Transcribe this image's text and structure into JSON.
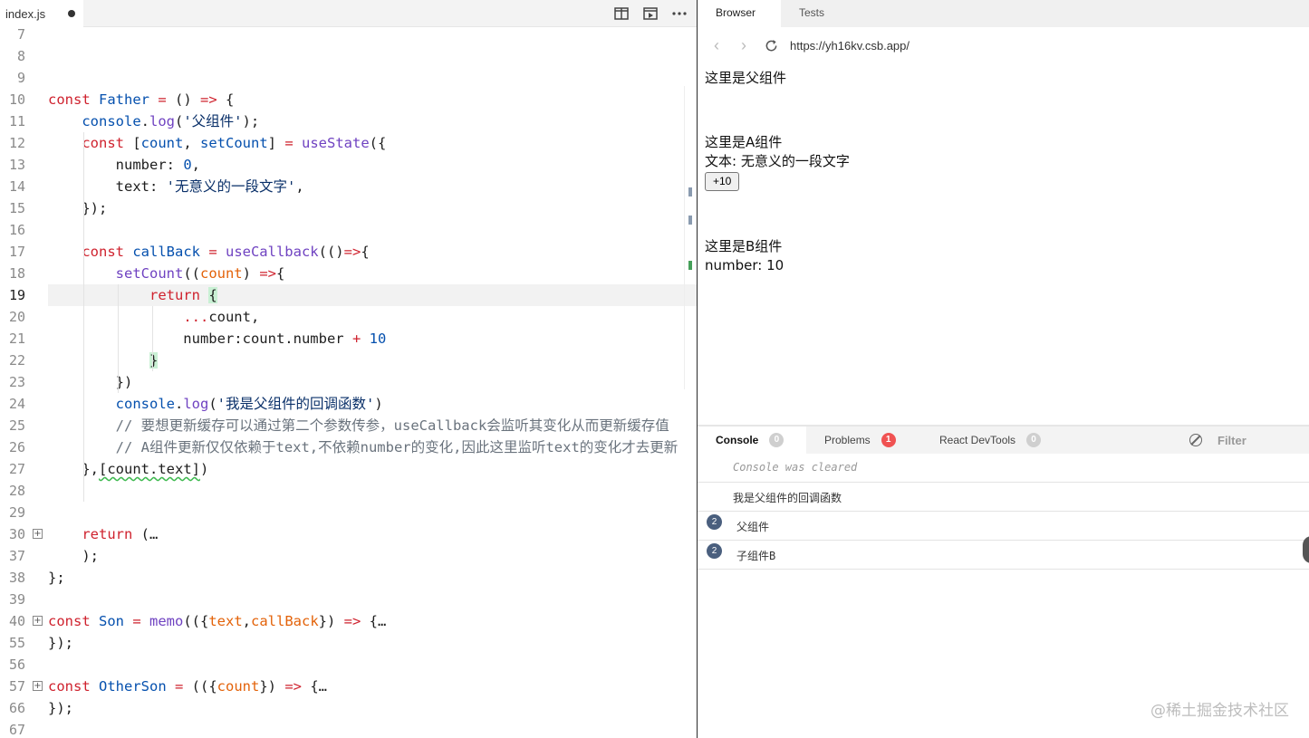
{
  "editor": {
    "file_name": "index.js",
    "actions": [
      "split-editor-icon",
      "preview-icon",
      "more-icon"
    ],
    "lines": [
      {
        "n": "7",
        "segs": []
      },
      {
        "n": "8",
        "segs": []
      },
      {
        "n": "9",
        "segs": []
      },
      {
        "n": "10",
        "segs": [
          [
            "kw",
            "const "
          ],
          [
            "vr",
            "Father"
          ],
          [
            "op",
            " = "
          ],
          [
            "",
            "() "
          ],
          [
            "op",
            "=>"
          ],
          [
            "",
            " {"
          ]
        ]
      },
      {
        "n": "11",
        "segs": [
          [
            "",
            "    "
          ],
          [
            "vr",
            "console"
          ],
          [
            "",
            "."
          ],
          [
            "fn",
            "log"
          ],
          [
            "",
            "("
          ],
          [
            "str",
            "'父组件'"
          ],
          [
            "",
            ");"
          ]
        ]
      },
      {
        "n": "12",
        "segs": [
          [
            "",
            "    "
          ],
          [
            "kw",
            "const "
          ],
          [
            "",
            "["
          ],
          [
            "vr",
            "count"
          ],
          [
            "",
            ", "
          ],
          [
            "vr",
            "setCount"
          ],
          [
            "",
            "] "
          ],
          [
            "op",
            "= "
          ],
          [
            "fn",
            "useState"
          ],
          [
            "",
            "({"
          ]
        ]
      },
      {
        "n": "13",
        "segs": [
          [
            "",
            "        number: "
          ],
          [
            "num",
            "0"
          ],
          [
            "",
            ","
          ]
        ]
      },
      {
        "n": "14",
        "segs": [
          [
            "",
            "        text: "
          ],
          [
            "str",
            "'无意义的一段文字'"
          ],
          [
            "",
            ","
          ]
        ]
      },
      {
        "n": "15",
        "segs": [
          [
            "",
            "    });"
          ]
        ]
      },
      {
        "n": "16",
        "segs": []
      },
      {
        "n": "17",
        "segs": [
          [
            "",
            "    "
          ],
          [
            "kw",
            "const "
          ],
          [
            "vr",
            "callBack"
          ],
          [
            "op",
            " = "
          ],
          [
            "fn",
            "useCallback"
          ],
          [
            "",
            "(()"
          ],
          [
            "op",
            "=>"
          ],
          [
            "",
            "{"
          ]
        ]
      },
      {
        "n": "18",
        "segs": [
          [
            "",
            "        "
          ],
          [
            "fn",
            "setCount"
          ],
          [
            "",
            "(("
          ],
          [
            "pm",
            "count"
          ],
          [
            "",
            ") "
          ],
          [
            "op",
            "=>"
          ],
          [
            "",
            "{"
          ]
        ]
      },
      {
        "n": "19",
        "current": true,
        "segs": [
          [
            "",
            "            "
          ],
          [
            "kw",
            "return "
          ],
          [
            "hl",
            "{"
          ]
        ]
      },
      {
        "n": "20",
        "segs": [
          [
            "",
            "                "
          ],
          [
            "op",
            "..."
          ],
          [
            "",
            "count,"
          ]
        ]
      },
      {
        "n": "21",
        "segs": [
          [
            "",
            "                number:count.number "
          ],
          [
            "op",
            "+ "
          ],
          [
            "num",
            "10"
          ]
        ]
      },
      {
        "n": "22",
        "segs": [
          [
            "",
            "            "
          ],
          [
            "hl",
            "}"
          ]
        ]
      },
      {
        "n": "23",
        "segs": [
          [
            "",
            "        })"
          ]
        ]
      },
      {
        "n": "24",
        "segs": [
          [
            "",
            "        "
          ],
          [
            "vr",
            "console"
          ],
          [
            "",
            "."
          ],
          [
            "fn",
            "log"
          ],
          [
            "",
            "("
          ],
          [
            "str",
            "'我是父组件的回调函数'"
          ],
          [
            "",
            ")"
          ]
        ]
      },
      {
        "n": "25",
        "segs": [
          [
            "",
            "        "
          ],
          [
            "cm",
            "// 要想更新缓存可以通过第二个参数传参，useCallback会监听其变化从而更新缓存值"
          ]
        ]
      },
      {
        "n": "26",
        "segs": [
          [
            "",
            "        "
          ],
          [
            "cm",
            "// A组件更新仅仅依赖于text,不依赖number的变化,因此这里监听text的变化才去更新"
          ]
        ]
      },
      {
        "n": "27",
        "segs": [
          [
            "",
            "    },"
          ],
          [
            "sq",
            "[count.text]"
          ],
          [
            "",
            ")"
          ]
        ]
      },
      {
        "n": "28",
        "segs": []
      },
      {
        "n": "29",
        "segs": []
      },
      {
        "n": "30",
        "fold": true,
        "segs": [
          [
            "",
            "    "
          ],
          [
            "kw",
            "return "
          ],
          [
            "",
            "(…"
          ]
        ]
      },
      {
        "n": "37",
        "segs": [
          [
            "",
            "    );"
          ]
        ]
      },
      {
        "n": "38",
        "segs": [
          [
            "",
            "};"
          ]
        ]
      },
      {
        "n": "39",
        "segs": []
      },
      {
        "n": "40",
        "fold": true,
        "segs": [
          [
            "kw",
            "const "
          ],
          [
            "vr",
            "Son"
          ],
          [
            "op",
            " = "
          ],
          [
            "fn",
            "memo"
          ],
          [
            "",
            "(({"
          ],
          [
            "pm",
            "text"
          ],
          [
            "",
            ","
          ],
          [
            "pm",
            "callBack"
          ],
          [
            "",
            "}) "
          ],
          [
            "op",
            "=>"
          ],
          [
            "",
            " {…"
          ]
        ]
      },
      {
        "n": "55",
        "segs": [
          [
            "",
            "});"
          ]
        ]
      },
      {
        "n": "56",
        "segs": []
      },
      {
        "n": "57",
        "fold": true,
        "segs": [
          [
            "kw",
            "const "
          ],
          [
            "vr",
            "OtherSon"
          ],
          [
            "op",
            " = "
          ],
          [
            "",
            "(({"
          ],
          [
            "pm",
            "count"
          ],
          [
            "",
            "}) "
          ],
          [
            "op",
            "=>"
          ],
          [
            "",
            " {…"
          ]
        ]
      },
      {
        "n": "66",
        "segs": [
          [
            "",
            "});"
          ]
        ]
      },
      {
        "n": "67",
        "segs": []
      }
    ]
  },
  "browser": {
    "tabs": [
      "Browser",
      "Tests"
    ],
    "active_tab": "Browser",
    "url": "https://yh16kv.csb.app/",
    "preview": {
      "father_title": "这里是父组件",
      "a_title": "这里是A组件",
      "a_text": "文本: 无意义的一段文字",
      "a_button": "+10",
      "b_title": "这里是B组件",
      "b_number": "number: 10"
    }
  },
  "console": {
    "tabs": [
      {
        "label": "Console",
        "badge": "0",
        "badge_color": "#cfcfcf"
      },
      {
        "label": "Problems",
        "badge": "1",
        "badge_color": "#f05252"
      },
      {
        "label": "React DevTools",
        "badge": "0",
        "badge_color": "#cfcfcf"
      }
    ],
    "filter_placeholder": "Filter",
    "rows": [
      {
        "text": "Console was cleared",
        "cleared": true,
        "count": null
      },
      {
        "text": "我是父组件的回调函数",
        "cleared": false,
        "count": null
      },
      {
        "text": "父组件",
        "cleared": false,
        "count": "2"
      },
      {
        "text": "子组件B",
        "cleared": false,
        "count": "2"
      }
    ]
  },
  "watermark": "@稀土掘金技术社区"
}
